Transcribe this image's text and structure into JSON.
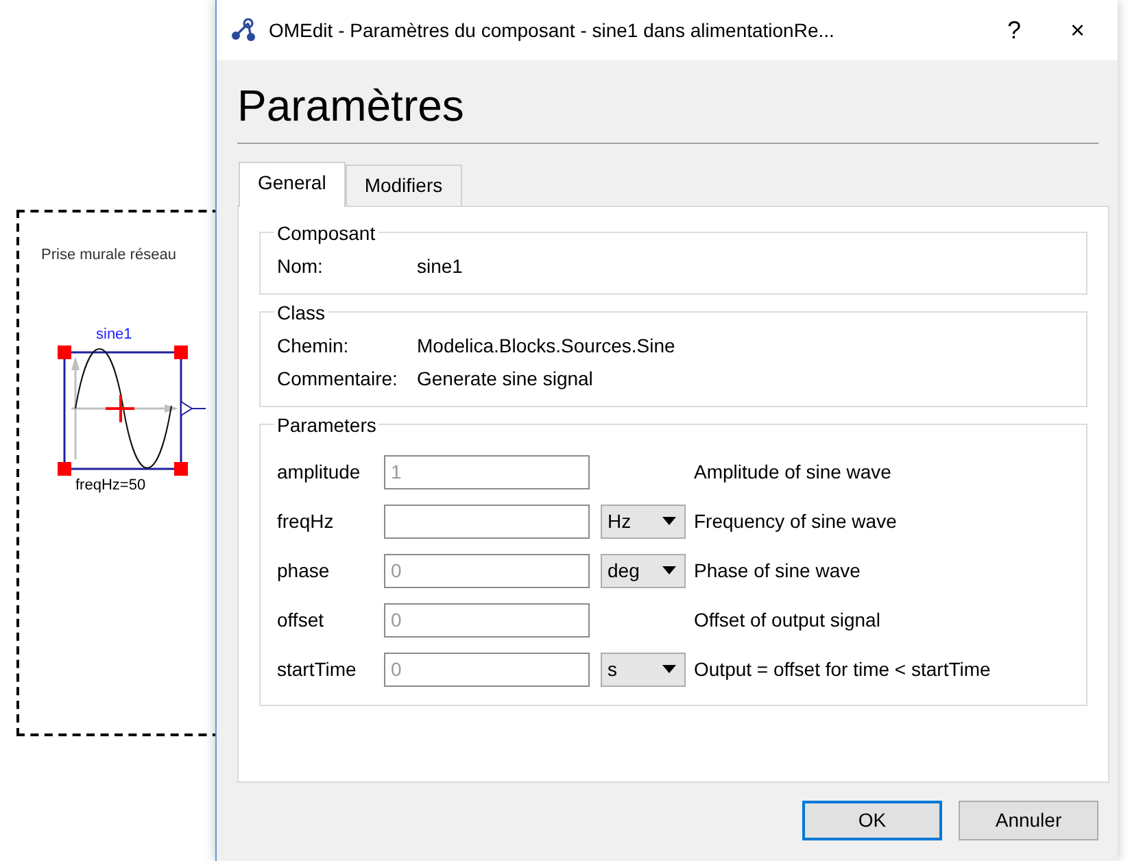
{
  "canvas": {
    "label": "Prise murale réseau",
    "component": {
      "name": "sine1",
      "annotation": "freqHz=50",
      "selected": true
    }
  },
  "dialog": {
    "title": "OMEdit - Paramètres du composant - sine1 dans alimentationRe...",
    "help": "?",
    "close": "×",
    "heading": "Paramètres",
    "tabs": [
      {
        "label": "General",
        "selected": true
      },
      {
        "label": "Modifiers",
        "selected": false
      }
    ],
    "groups": [
      {
        "title": "Composant",
        "kind": "fields",
        "fields": [
          {
            "label": "Nom:",
            "value": "sine1"
          }
        ]
      },
      {
        "title": "Class",
        "kind": "fields",
        "fields": [
          {
            "label": "Chemin:",
            "value": "Modelica.Blocks.Sources.Sine"
          },
          {
            "label": "Commentaire:",
            "value": "Generate sine signal"
          }
        ]
      },
      {
        "title": "Parameters",
        "kind": "parameters",
        "rows": [
          {
            "name": "amplitude",
            "placeholder": "1",
            "description": "Amplitude of sine wave"
          },
          {
            "name": "freqHz",
            "unit": "Hz",
            "description": "Frequency of sine wave"
          },
          {
            "name": "phase",
            "placeholder": "0",
            "unit": "deg",
            "description": "Phase of sine wave"
          },
          {
            "name": "offset",
            "placeholder": "0",
            "description": "Offset of output signal"
          },
          {
            "name": "startTime",
            "placeholder": "0",
            "unit": "s",
            "description": "Output = offset for time < startTime"
          }
        ]
      }
    ],
    "buttons": [
      {
        "label": "OK",
        "default": true
      },
      {
        "label": "Annuler",
        "default": false
      }
    ]
  }
}
